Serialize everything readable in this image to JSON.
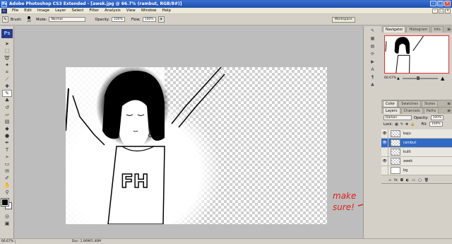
{
  "window": {
    "title": "Adobe Photoshop CS3 Extended - [awek.jpg @ 66.7% (rambut, RGB/8#)]",
    "app_icon_label": "Ps"
  },
  "menu": {
    "items": [
      "File",
      "Edit",
      "Image",
      "Layer",
      "Select",
      "Filter",
      "Analysis",
      "View",
      "Window",
      "Help"
    ]
  },
  "options": {
    "brush_label": "Brush:",
    "brush_size": "20",
    "mode_label": "Mode:",
    "mode_value": "Normal",
    "opacity_label": "Opacity:",
    "opacity_value": "100%",
    "flow_label": "Flow:",
    "flow_value": "100%",
    "workspace_label": "Workspace"
  },
  "toolbox": {
    "logo": "Ps",
    "foreground_color": "#000000",
    "background_color": "#ffffff"
  },
  "artwork": {
    "shirt_text": "FH"
  },
  "navigator": {
    "tabs": [
      "Navigator",
      "Histogram",
      "Info"
    ],
    "zoom": "66.67%"
  },
  "color_panel": {
    "tabs": [
      "Color",
      "Swatches",
      "Styles"
    ]
  },
  "layers_panel": {
    "tabs": [
      "Layers",
      "Channels",
      "Paths"
    ],
    "blend_mode": "Darken",
    "opacity_label": "Opacity:",
    "opacity_value": "100%",
    "lock_label": "Lock:",
    "fill_label": "Fill:",
    "fill_value": "100%",
    "layers": [
      {
        "name": "baju",
        "visible": true,
        "selected": false
      },
      {
        "name": "rambut",
        "visible": true,
        "selected": true
      },
      {
        "name": "kulit",
        "visible": false,
        "selected": false
      },
      {
        "name": "awek",
        "visible": true,
        "selected": false
      },
      {
        "name": "bg",
        "visible": false,
        "selected": false
      }
    ]
  },
  "status": {
    "zoom": "66.67%",
    "doc": "Doc: 1.90M/5.40M"
  },
  "annotation": {
    "text": "make sure!",
    "color": "#e0201a"
  },
  "colors": {
    "selection_blue": "#316ac5",
    "title_blue": "#1f4fae"
  }
}
